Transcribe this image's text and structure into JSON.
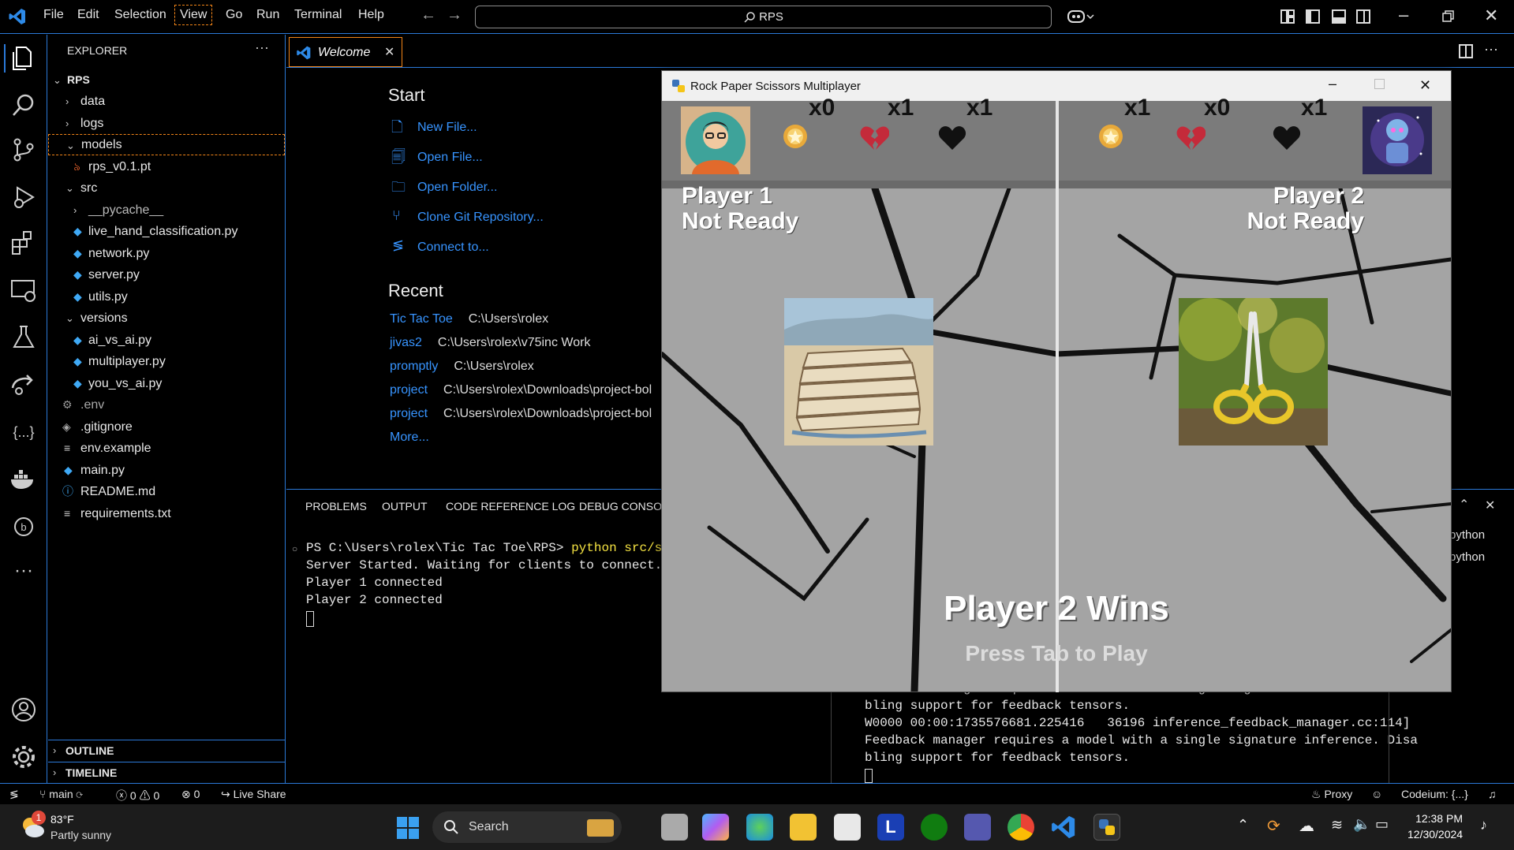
{
  "menu": [
    "File",
    "Edit",
    "Selection",
    "View",
    "Go",
    "Run",
    "Terminal",
    "Help"
  ],
  "search": {
    "text": "RPS"
  },
  "explorer": {
    "title": "EXPLORER",
    "more": "···",
    "root": "RPS",
    "items": [
      {
        "label": "data",
        "type": "folder"
      },
      {
        "label": "logs",
        "type": "folder"
      },
      {
        "label": "models",
        "type": "folder-open"
      },
      {
        "label": "rps_v0.1.pt",
        "type": "file"
      },
      {
        "label": "src",
        "type": "folder-open"
      },
      {
        "label": "__pycache__",
        "type": "folder"
      },
      {
        "label": "live_hand_classification.py",
        "type": "py"
      },
      {
        "label": "network.py",
        "type": "py"
      },
      {
        "label": "server.py",
        "type": "py"
      },
      {
        "label": "utils.py",
        "type": "py"
      },
      {
        "label": "versions",
        "type": "folder-open"
      },
      {
        "label": "ai_vs_ai.py",
        "type": "py"
      },
      {
        "label": "multiplayer.py",
        "type": "py"
      },
      {
        "label": "you_vs_ai.py",
        "type": "py"
      },
      {
        "label": ".env",
        "type": "gear"
      },
      {
        "label": ".gitignore",
        "type": "git"
      },
      {
        "label": "env.example",
        "type": "text"
      },
      {
        "label": "main.py",
        "type": "py"
      },
      {
        "label": "README.md",
        "type": "info"
      },
      {
        "label": "requirements.txt",
        "type": "text"
      }
    ],
    "outline": "OUTLINE",
    "timeline": "TIMELINE"
  },
  "editor": {
    "tab_label": "Welcome",
    "start_heading": "Start",
    "start_links": [
      "New File...",
      "Open File...",
      "Open Folder...",
      "Clone Git Repository...",
      "Connect to..."
    ],
    "recent_heading": "Recent",
    "recent": [
      {
        "name": "Tic Tac Toe",
        "path": "C:\\Users\\rolex"
      },
      {
        "name": "jivas2",
        "path": "C:\\Users\\rolex\\v75inc Work"
      },
      {
        "name": "promptly",
        "path": "C:\\Users\\rolex"
      },
      {
        "name": "project",
        "path": "C:\\Users\\rolex\\Downloads\\project-bol"
      },
      {
        "name": "project",
        "path": "C:\\Users\\rolex\\Downloads\\project-bol"
      }
    ],
    "more": "More..."
  },
  "panel": {
    "tabs": [
      "PROBLEMS",
      "OUTPUT",
      "CODE REFERENCE LOG",
      "DEBUG CONSOLE"
    ],
    "terminal_prompt": "PS C:\\Users\\rolex\\Tic Tac Toe\\RPS> ",
    "terminal_cmd": "python src/serv",
    "terminal_lines": [
      "Server Started. Waiting for clients to connect...",
      "Player 1 connected",
      "Player 2 connected"
    ],
    "right_lines": [
      "Feedback manager requires a model with a single signature inference. Disa",
      "bling support for feedback tensors.",
      "W0000 00:00:1735576681.225416   36196 inference_feedback_manager.cc:114]",
      "Feedback manager requires a model with a single signature inference. Disa",
      "bling support for feedback tensors."
    ],
    "terminal_list": [
      "python",
      "python"
    ]
  },
  "game": {
    "title": "Rock Paper Scissors Multiplayer",
    "p1": {
      "name": "Player 1",
      "status": "Not Ready",
      "wins": "x0",
      "losses": "x1",
      "ties": "x1"
    },
    "p2": {
      "name": "Player 2",
      "status": "Not Ready",
      "wins": "x1",
      "losses": "x0",
      "ties": "x1"
    },
    "result": "Player 2 Wins",
    "prompt": "Press Tab to Play"
  },
  "status": {
    "branch": "main",
    "errors": "0",
    "warnings": "0",
    "ports": "0",
    "live_share": "Live Share",
    "proxy": "Proxy",
    "codeium": "Codeium: {...}"
  },
  "taskbar": {
    "weather_temp": "83°F",
    "weather_desc": "Partly sunny",
    "weather_badge": "1",
    "search": "Search",
    "time": "12:38 PM",
    "date": "12/30/2024"
  },
  "colors": {
    "accent": "#2b79d8",
    "link": "#3794ff",
    "python": "#3fa9f5"
  }
}
